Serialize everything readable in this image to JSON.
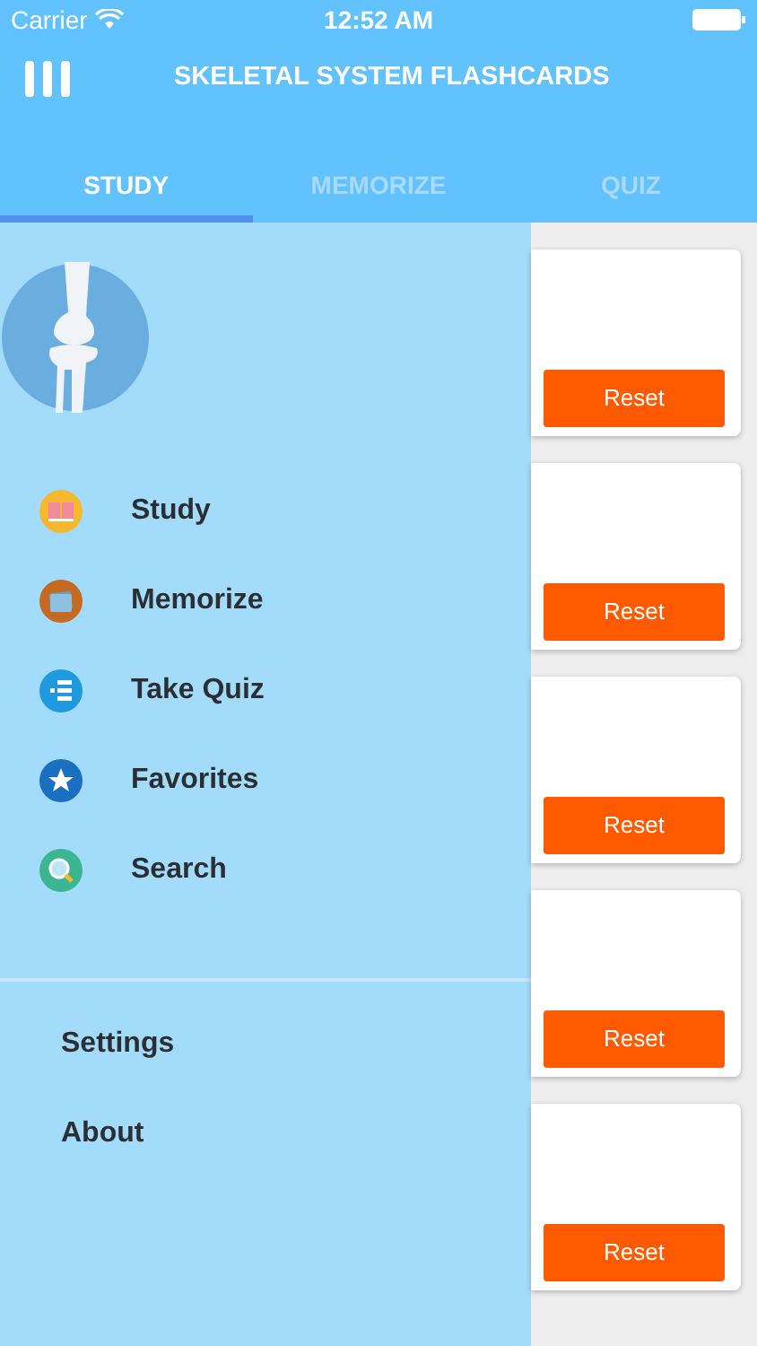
{
  "status_bar": {
    "carrier": "Carrier",
    "time": "12:52 AM"
  },
  "header": {
    "title": "SKELETAL SYSTEM FLASHCARDS"
  },
  "tabs": [
    {
      "label": "STUDY",
      "selected": true
    },
    {
      "label": "MEMORIZE",
      "selected": false
    },
    {
      "label": "QUIZ",
      "selected": false
    }
  ],
  "drawer": {
    "items": [
      {
        "label": "Study",
        "kind": "study"
      },
      {
        "label": "Memorize",
        "kind": "memorize"
      },
      {
        "label": "Take Quiz",
        "kind": "quiz"
      },
      {
        "label": "Favorites",
        "kind": "favorites"
      },
      {
        "label": "Search",
        "kind": "search"
      }
    ],
    "secondary_items": [
      {
        "label": "Settings"
      },
      {
        "label": "About"
      }
    ]
  },
  "cards": [
    {
      "button": "Reset"
    },
    {
      "button": "Reset"
    },
    {
      "button": "Reset"
    },
    {
      "button": "Reset"
    },
    {
      "button": "Reset"
    }
  ]
}
